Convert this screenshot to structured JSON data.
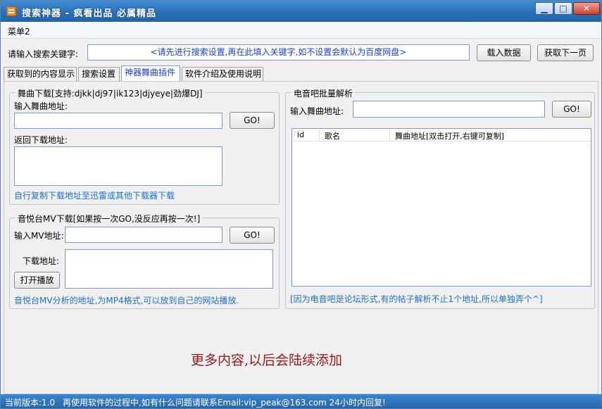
{
  "window": {
    "title": "搜索神器 - 疯看出品 必属精品",
    "controls": {
      "minimize": "▁",
      "maximize": "□",
      "close": "✕"
    }
  },
  "menu": {
    "items": [
      "菜单2"
    ]
  },
  "search": {
    "label": "请输入搜索关键字:",
    "placeholder": "<请先进行搜索设置,再在此填入关键字,如不设置会默认为百度网盘>",
    "load_button": "载入数据",
    "next_button": "获取下一页"
  },
  "tabs": [
    {
      "label": "获取到的内容显示",
      "active": false
    },
    {
      "label": "搜索设置",
      "active": false
    },
    {
      "label": "神器舞曲插件",
      "active": true
    },
    {
      "label": "软件介绍及使用说明",
      "active": false
    }
  ],
  "dance_download": {
    "title": "舞曲下载[支持:djkk|dj97|ik123|djyeye|劲爆DJ]",
    "input_label": "输入舞曲地址:",
    "go_button": "GO!",
    "return_label": "返回下载地址:",
    "hint": "自行复制下载地址至迅雷或其他下载器下载"
  },
  "mv_download": {
    "title": "音悦台MV下载[如果按一次GO,没反应再按一次!]",
    "input_label": "输入MV地址:",
    "go_button": "GO!",
    "download_label": "下载地址:",
    "play_button": "打开播放",
    "hint": "音悦台MV分析的地址,为MP4格式,可以放到自己的网站播放."
  },
  "batch_parse": {
    "title": "电音吧批量解析",
    "input_label": "输入舞曲地址:",
    "go_button": "GO!",
    "columns": [
      "id",
      "歌名",
      "舞曲地址[双击打开,右键可复制]"
    ],
    "rows": [],
    "hint": "[因为电音吧是论坛形式,有的帖子解析不止1个地址,所以单独弄个^]"
  },
  "footer_note": "更多内容,以后会陆续添加",
  "status": {
    "version": "当前版本:1.0",
    "contact": "再使用软件的过程中,如有什么问题请联系Email:vip_peak@163.com 24小时内回复!"
  },
  "colors": {
    "title_bar": "#2a6fb7",
    "accent_blue": "#1f6fcf",
    "placeholder_blue": "#1a40d6",
    "footer_red": "#a01818"
  },
  "icons": {
    "app": "rss-feed-icon"
  }
}
